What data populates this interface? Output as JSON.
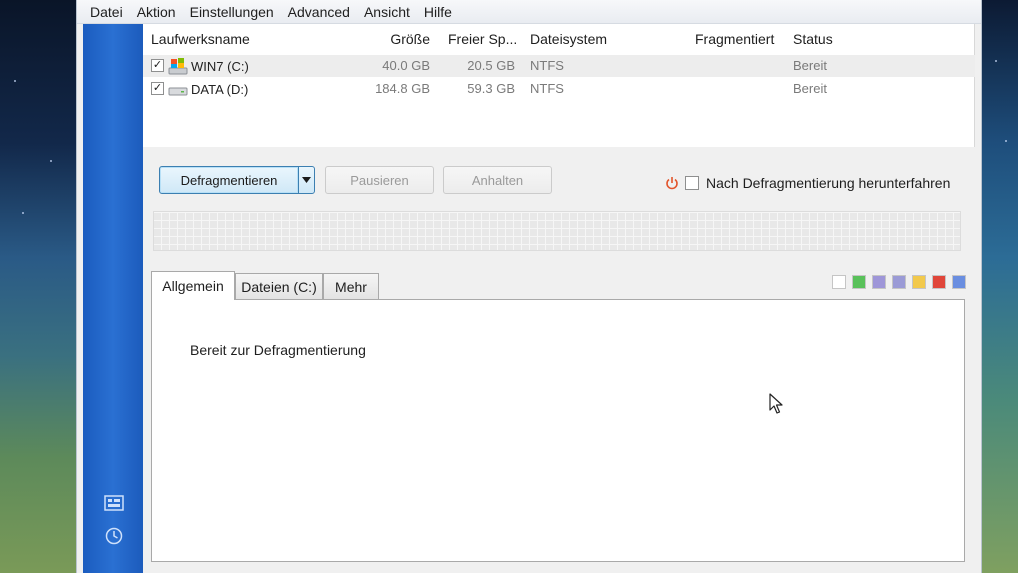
{
  "menu": [
    "Datei",
    "Aktion",
    "Einstellungen",
    "Advanced",
    "Ansicht",
    "Hilfe"
  ],
  "drive_list": {
    "columns": [
      "Laufwerksname",
      "Größe",
      "Freier Sp...",
      "Dateisystem",
      "Fragmentiert",
      "Status"
    ],
    "rows": [
      {
        "checked": true,
        "name": "WIN7 (C:)",
        "size": "40.0 GB",
        "free": "20.5 GB",
        "fs": "NTFS",
        "fragmented": "",
        "status": "Bereit",
        "icon": "system-drive-icon"
      },
      {
        "checked": true,
        "name": "DATA (D:)",
        "size": "184.8 GB",
        "free": "59.3 GB",
        "fs": "NTFS",
        "fragmented": "",
        "status": "Bereit",
        "icon": "hard-drive-icon"
      }
    ]
  },
  "toolbar": {
    "defrag_label": "Defragmentieren",
    "pause_label": "Pausieren",
    "stop_label": "Anhalten",
    "shutdown_label": "Nach Defragmentierung herunterfahren"
  },
  "tabs": [
    "Allgemein",
    "Dateien (C:)",
    "Mehr"
  ],
  "panel": {
    "status_text": "Bereit zur Defragmentierung"
  },
  "legend_colors": [
    "#ffffff",
    "#59c15a",
    "#9e96d8",
    "#9b9bd6",
    "#f2c94c",
    "#e0463a",
    "#6a8ee0"
  ],
  "colors": {
    "sidebar": "#2a70d2",
    "power_icon": "#e2542b"
  }
}
